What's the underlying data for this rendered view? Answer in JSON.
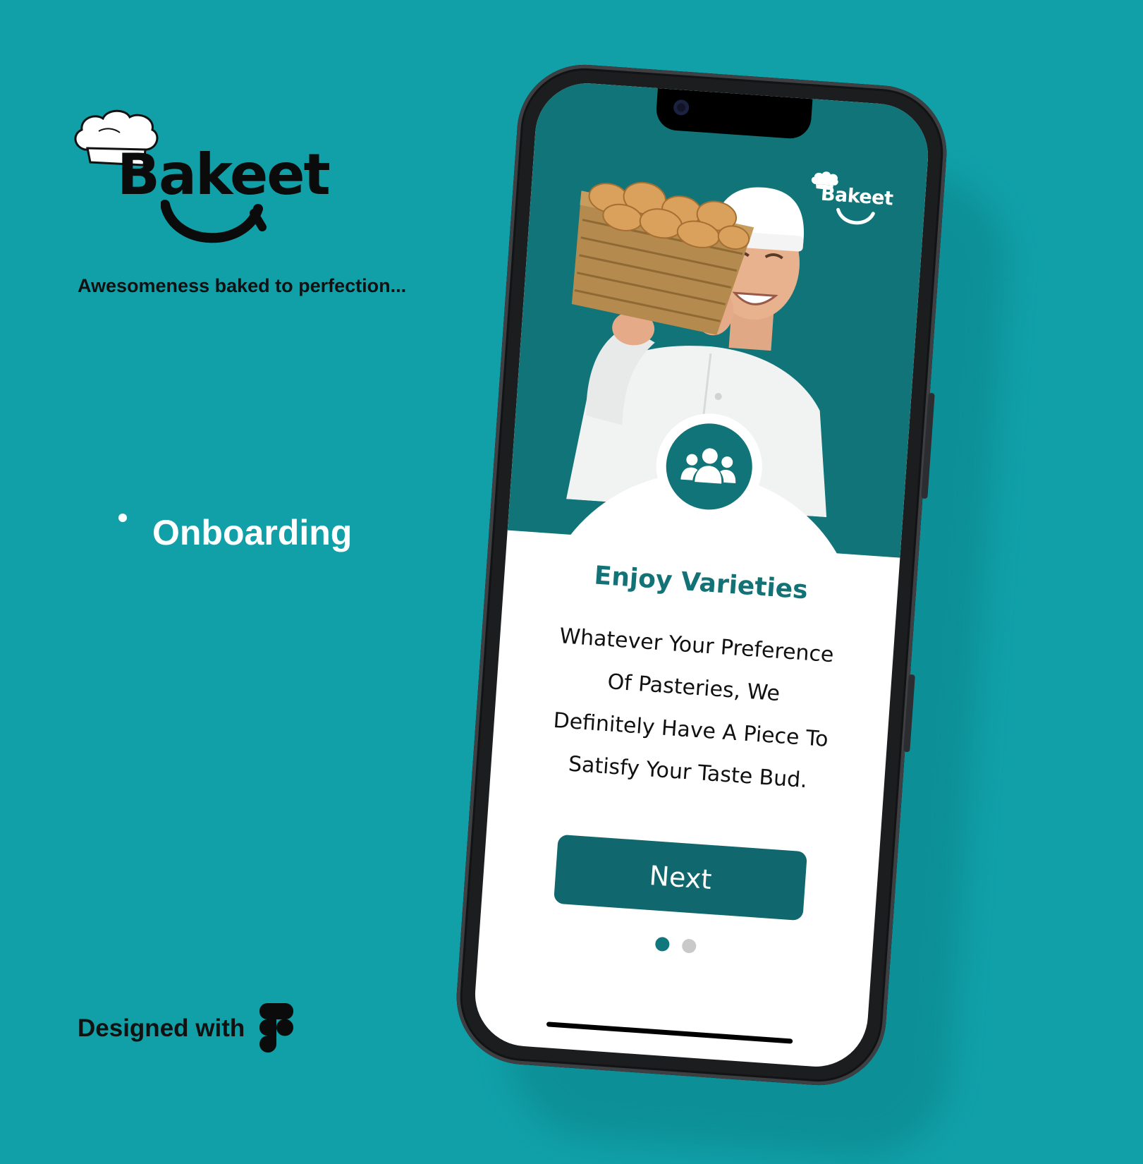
{
  "brand": {
    "name": "Bakeet",
    "tagline": "Awesomeness baked to perfection..."
  },
  "section": {
    "title": "Onboarding"
  },
  "footer": {
    "designed_with": "Designed with",
    "tool_icon": "figma-icon"
  },
  "phone": {
    "app_logo": "Bakeet",
    "hero_image": "baker-holding-bread-basket",
    "feature_icon": "users-group-icon",
    "title": "Enjoy Varieties",
    "description": "Whatever Your Preference Of Pasteries, We Definitely Have A Piece To Satisfy Your Taste Bud.",
    "next_label": "Next",
    "pagination": {
      "total": 2,
      "current": 1
    }
  },
  "colors": {
    "background": "#11a0a8",
    "primary": "#107478",
    "button": "#10686e",
    "dot_inactive": "#c9c9c9"
  }
}
